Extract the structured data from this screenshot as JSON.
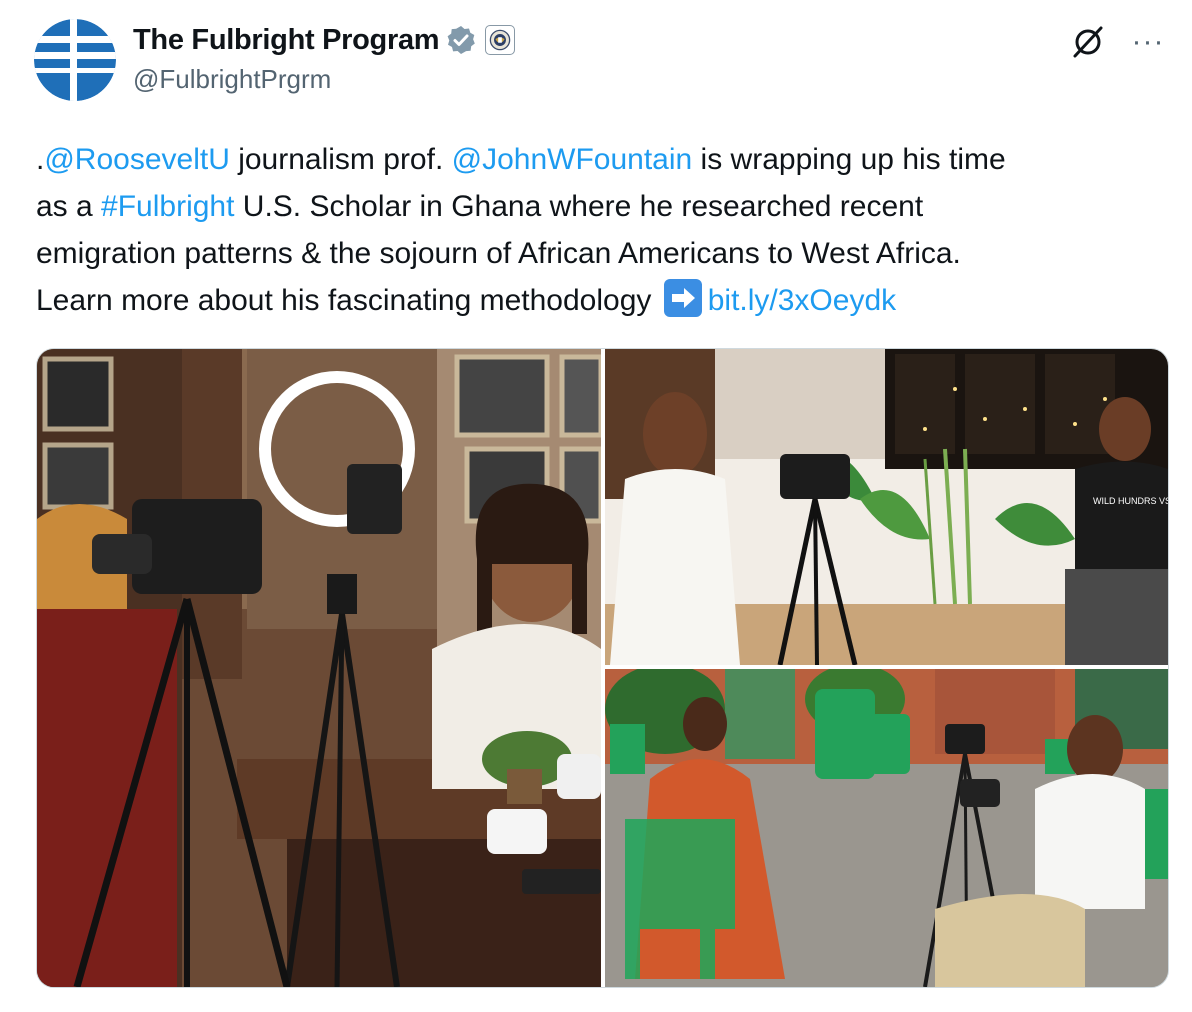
{
  "account": {
    "name": "The Fulbright Program",
    "handle": "@FulbrightPrgrm",
    "verified_icon": "verified-badge-icon",
    "affiliate_icon": "government-seal-icon"
  },
  "actions": {
    "grok_icon": "grok-icon",
    "more_label": "···"
  },
  "tweet": {
    "line1_prefix": ".",
    "mention1": "@RooseveltU",
    "line1_mid": " journalism prof. ",
    "mention2": "@JohnWFountain",
    "line1_end": " is wrapping up his time",
    "line2_start": "as a ",
    "hashtag": "#Fulbright",
    "line2_end": " U.S. Scholar in Ghana where he researched recent",
    "line3": "emigration patterns & the sojourn of African Americans to West Africa.",
    "line4_start": "Learn more about his fascinating methodology ",
    "arrow_emoji": "➡️",
    "link": "bit.ly/3xOeydk"
  },
  "media": {
    "shirt_text": "WILD HUNDRS VS EVERYBODY",
    "colors": {
      "link": "#1d9bf0",
      "text": "#0f1419",
      "secondary": "#536471",
      "border": "#cfd9de"
    }
  }
}
